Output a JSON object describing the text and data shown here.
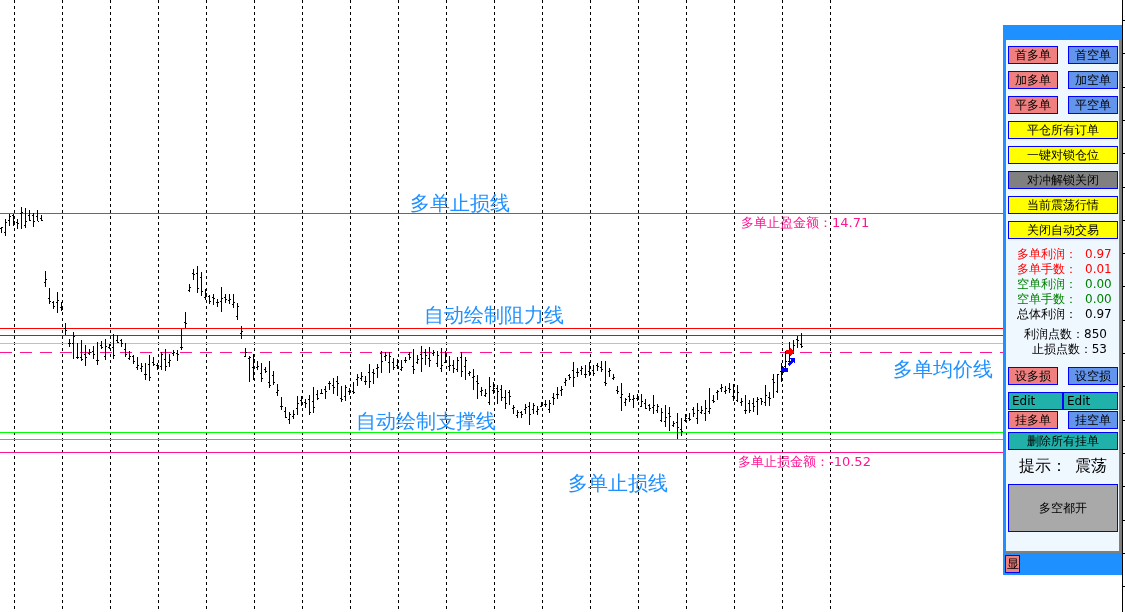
{
  "chart": {
    "upper_line_label": "多单止损线",
    "upper_line_amount": "多单止盈金额：14.71",
    "resistance_label": "自动绘制阻力线",
    "average_price_label": "多单均价线",
    "support_label": "自动绘制支撑线",
    "lower_line_label": "多单止损线",
    "lower_line_amount": "多单止损金额：-10.52"
  },
  "panel": {
    "order_rows": [
      [
        {
          "label": "首多单",
          "color": "#f08080"
        },
        {
          "label": "首空单",
          "color": "#6495ed"
        }
      ],
      [
        {
          "label": "加多单",
          "color": "#f08080"
        },
        {
          "label": "加空单",
          "color": "#6495ed"
        }
      ],
      [
        {
          "label": "平多单",
          "color": "#f08080"
        },
        {
          "label": "平空单",
          "color": "#6495ed"
        }
      ]
    ],
    "action_buttons": [
      {
        "label": "平仓所有订单",
        "color": "#ffff00"
      },
      {
        "label": "一键对锁仓位",
        "color": "#ffff00"
      },
      {
        "label": "对冲解锁关闭",
        "color": "#808080"
      },
      {
        "label": "当前震荡行情",
        "color": "#ffff00"
      },
      {
        "label": "关闭自动交易",
        "color": "#ffff00"
      }
    ],
    "stats": [
      {
        "kind": "long",
        "label": "多单利润：",
        "value": "0.97"
      },
      {
        "kind": "long",
        "label": "多单手数：",
        "value": "0.01"
      },
      {
        "kind": "short",
        "label": "空单利润：",
        "value": "0.00"
      },
      {
        "kind": "short",
        "label": "空单手数：",
        "value": "0.00"
      },
      {
        "kind": "total",
        "label": "总体利润：",
        "value": "0.97"
      }
    ],
    "points": [
      {
        "label": "利润点数：",
        "value": "850"
      },
      {
        "label": "止损点数：",
        "value": "53"
      }
    ],
    "stop_buttons": [
      {
        "label": "设多损",
        "color": "#f08080"
      },
      {
        "label": "设空损",
        "color": "#6495ed"
      }
    ],
    "edit_fields": [
      {
        "value": "Edit"
      },
      {
        "value": "Edit"
      }
    ],
    "pending_buttons": [
      {
        "label": "挂多单",
        "color": "#f08080"
      },
      {
        "label": "挂空单",
        "color": "#6495ed"
      }
    ],
    "delete_button": {
      "label": "删除所有挂单",
      "color": "#20b2aa"
    },
    "hint": {
      "label": "提示：",
      "value": "震荡"
    },
    "mode_button": {
      "label": "多空都开",
      "color": "#a9a9a9"
    },
    "show_button": {
      "label": "显",
      "color": "#f08080"
    }
  }
}
